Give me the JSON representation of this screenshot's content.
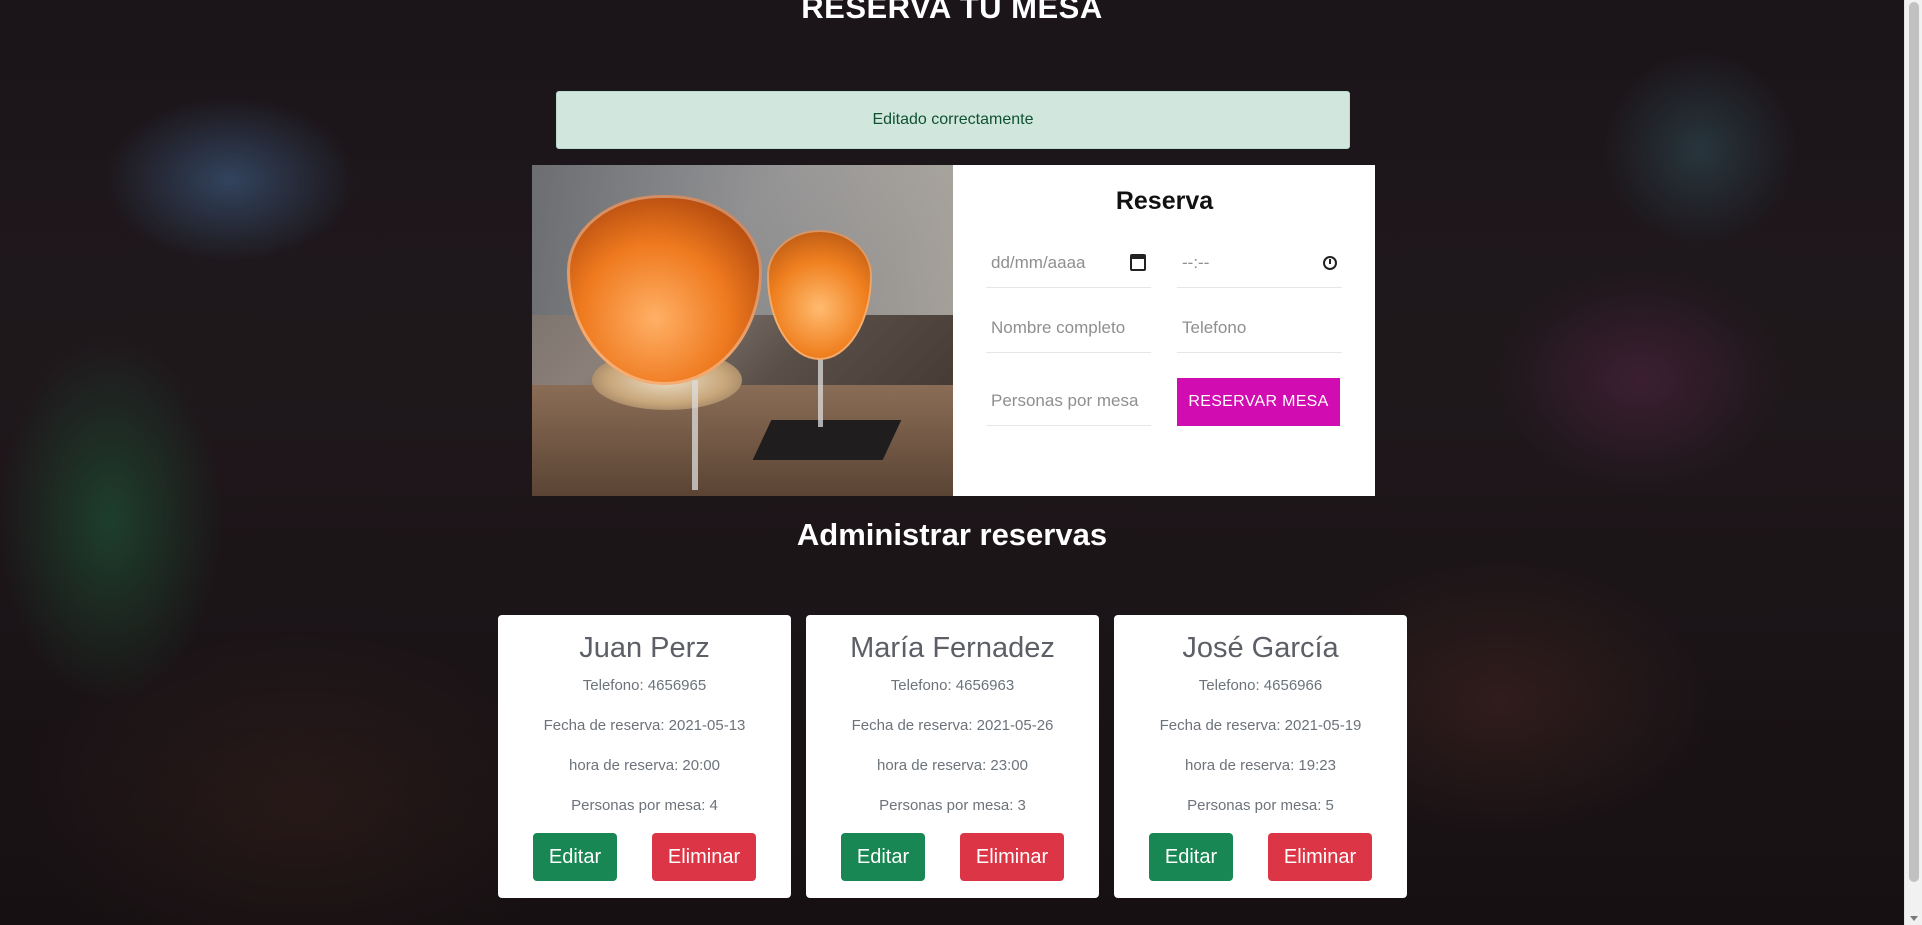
{
  "page": {
    "title": "RESERVA TU MESA"
  },
  "alert": {
    "message": "Editado correctamente"
  },
  "reservation_form": {
    "title": "Reserva",
    "date_placeholder": "dd/mm/aaaa",
    "time_placeholder": "--:--",
    "name_placeholder": "Nombre completo",
    "phone_placeholder": "Telefono",
    "people_placeholder": "Personas por mesa",
    "submit_label": "RESERVAR MESA",
    "submit_color": "#d10cb0"
  },
  "admin": {
    "title": "Administrar reservas",
    "edit_label": "Editar",
    "delete_label": "Eliminar",
    "edit_color": "#198754",
    "delete_color": "#dc3545",
    "reservations": [
      {
        "name": "Juan Perz",
        "phone": "Telefono: 4656965",
        "date": "Fecha de reserva: 2021-05-13",
        "time": "hora de reserva: 20:00",
        "people": "Personas por mesa: 4"
      },
      {
        "name": "María Fernadez",
        "phone": "Telefono: 4656963",
        "date": "Fecha de reserva: 2021-05-26",
        "time": "hora de reserva: 23:00",
        "people": "Personas por mesa: 3"
      },
      {
        "name": "José García",
        "phone": "Telefono: 4656966",
        "date": "Fecha de reserva: 2021-05-19",
        "time": "hora de reserva: 19:23",
        "people": "Personas por mesa: 5"
      }
    ]
  }
}
